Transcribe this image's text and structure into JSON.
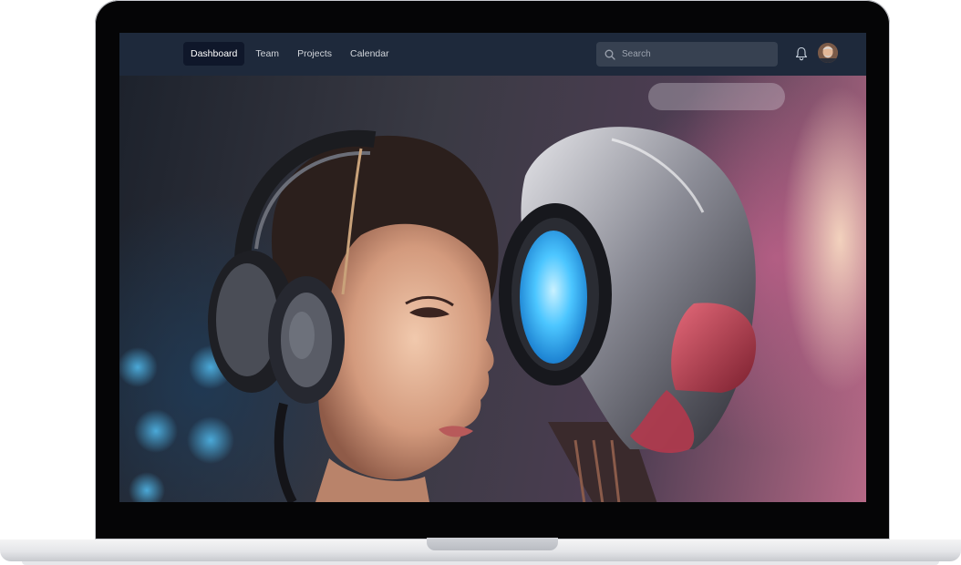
{
  "navbar": {
    "links": [
      {
        "label": "Dashboard",
        "active": true
      },
      {
        "label": "Team",
        "active": false
      },
      {
        "label": "Projects",
        "active": false
      },
      {
        "label": "Calendar",
        "active": false
      }
    ],
    "search": {
      "placeholder": "Search"
    },
    "icons": {
      "search": "search-icon",
      "notifications": "bell-icon",
      "avatar": "user-avatar"
    }
  },
  "colors": {
    "navbar_bg": "#1e293b",
    "active_link_bg": "#0f172a",
    "search_bg": "#374151",
    "visor_glow": "#35b8ff",
    "helmet_red": "#c23f55"
  }
}
